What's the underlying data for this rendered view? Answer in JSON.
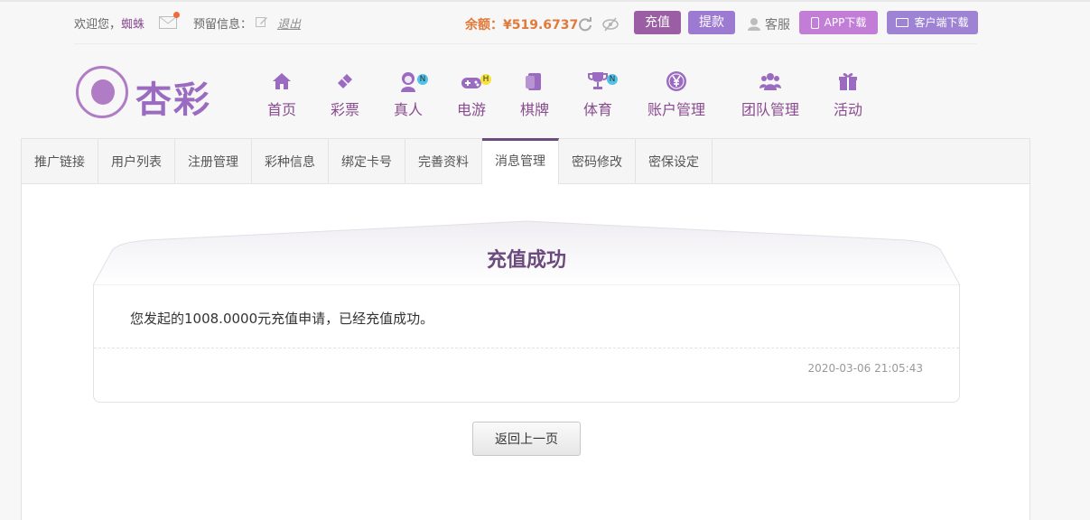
{
  "header": {
    "welcome_label": "欢迎您，",
    "username": "蜘蛛",
    "reserved_info_label": "预留信息：",
    "logout_label": "退出",
    "balance_label": "余额：",
    "balance_value": "¥519.6737",
    "recharge_label": "充值",
    "withdraw_label": "提款",
    "service_label": "客服",
    "app_download_label": "APP下载",
    "client_download_label": "客户端下载"
  },
  "logo": {
    "text": "杏彩"
  },
  "nav": {
    "items": [
      {
        "label": "首页",
        "icon": "home-icon"
      },
      {
        "label": "彩票",
        "icon": "ticket-icon"
      },
      {
        "label": "真人",
        "icon": "woman-icon",
        "badge": "N"
      },
      {
        "label": "电游",
        "icon": "gamepad-icon",
        "badge": "H"
      },
      {
        "label": "棋牌",
        "icon": "cards-icon"
      },
      {
        "label": "体育",
        "icon": "trophy-icon",
        "badge": "N"
      },
      {
        "label": "账户管理",
        "icon": "yen-coin-icon"
      },
      {
        "label": "团队管理",
        "icon": "team-icon"
      },
      {
        "label": "活动",
        "icon": "gift-icon"
      }
    ]
  },
  "tabs": [
    {
      "label": "推广链接"
    },
    {
      "label": "用户列表"
    },
    {
      "label": "注册管理"
    },
    {
      "label": "彩种信息"
    },
    {
      "label": "绑定卡号"
    },
    {
      "label": "完善资料"
    },
    {
      "label": "消息管理",
      "active": true
    },
    {
      "label": "密码修改"
    },
    {
      "label": "密保设定"
    }
  ],
  "message": {
    "title": "充值成功",
    "body": "您发起的1008.0000元充值申请，已经充值成功。",
    "timestamp": "2020-03-06 21:05:43"
  },
  "back_button_label": "返回上一页",
  "colors": {
    "brand_purple": "#8a4b90",
    "balance_orange": "#e07a3a",
    "title_purple": "#6b4a7e"
  }
}
